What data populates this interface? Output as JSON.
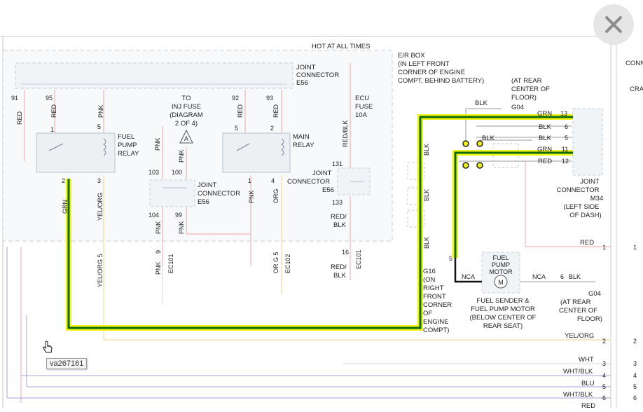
{
  "viewer": {
    "tooltip": "va267161"
  },
  "header": {
    "hot_at_all_times": "HOT AT ALL TIMES"
  },
  "right_panel": {
    "conn": "CONN",
    "cra": "CRA"
  },
  "components": {
    "joint_connector_e56_top": [
      "JOINT",
      "CONNECTOR",
      "E56"
    ],
    "fuel_pump_relay": [
      "FUEL",
      "PUMP",
      "RELAY"
    ],
    "main_relay": [
      "MAIN",
      "RELAY"
    ],
    "inj_fuse": [
      "TO",
      "INJ FUSE",
      "(DIAGRAM",
      "2 OF 4)"
    ],
    "inj_fuse_marker": "A",
    "joint_connector_e56_mid": [
      "JOINT",
      "CONNECTOR",
      "E56"
    ],
    "joint_connector_e56_right": [
      "JOINT",
      "CONNECTOR",
      "E56"
    ],
    "ecu_fuse": [
      "ECU",
      "FUSE",
      "10A"
    ],
    "er_box": [
      "E/R BOX",
      "(IN LEFT FRONT",
      "CORNER OF ENGINE",
      "COMPT, BEHIND BATTERY)"
    ],
    "g04_top": [
      "(AT REAR",
      "CENTER OF",
      "FLOOR)",
      "G04"
    ],
    "joint_connector_m34": [
      "JOINT",
      "CONNECTOR",
      "M34",
      "(LEFT SIDE",
      "OF DASH)"
    ],
    "fuel_pump_motor": [
      "FUEL",
      "PUMP",
      "MOTOR"
    ],
    "motor_symbol": "M",
    "fuel_sender": [
      "FUEL SENDER &",
      "FUEL PUMP MOTOR",
      "(BELOW CENTER OF",
      "REAR SEAT)"
    ],
    "g16": [
      "G16",
      "(ON",
      "RIGHT",
      "FRONT",
      "CORNER",
      "OF",
      "ENGINE",
      "COMPT)"
    ],
    "g04_bottom": [
      "G04",
      "(AT REAR",
      "CENTER OF",
      "FLOOR)"
    ]
  },
  "wires": {
    "red_91": "RED",
    "red_95": "RED",
    "pnk_5": "PNK",
    "red_92": "RED",
    "red_93": "RED",
    "pnk_inj": "PNK",
    "pnk_a": "PNK",
    "pnk_1": "PNK",
    "org_4": "ORG",
    "red_blk": "RED/BLK",
    "grn_2": "GRN",
    "yel_org_3": "YEL/ORG",
    "pnk_104": "PNK",
    "pnk_99": "PNK",
    "red_blk_133": [
      "RED/",
      "BLK"
    ],
    "yel_org_5": "YEL/ORG 5",
    "ec101_9": "9",
    "pnk_ec101": "PNK",
    "ec101": "EC101",
    "org_5": "OR G  5",
    "ec102": "EC102",
    "red_blk_16": [
      "RED/",
      "BLK"
    ],
    "pin16": "16",
    "ec101b": "EC101",
    "blk_g04": "BLK",
    "grn_13": "GRN",
    "blk_6": "BLK",
    "blk_5": "BLK",
    "grn_11": "GRN",
    "red_12": "RED",
    "blk_mid": "BLK",
    "blk_vert1": "BLK",
    "blk_vert2": "BLK",
    "blk_vert3": "BLK",
    "nca_left": "NCA",
    "nca_right": "NCA",
    "blk_right": "BLK",
    "pin6_bottom": "6",
    "red_bottom": "RED",
    "yel_org_bottom": "YEL/ORG",
    "wht": "WHT",
    "wht_blk": "WHT/BLK",
    "blu": "BLU",
    "wht_blk_2": "WHT/BLK",
    "red_last": "RED"
  },
  "pins": {
    "p91": "91",
    "p95": "95",
    "p92": "92",
    "p93": "93",
    "p1_fpr": "1",
    "p5_fpr": "5",
    "p2_fpr": "2",
    "p3_fpr": "3",
    "p5_mr": "5",
    "p2_mr": "2",
    "p1_mr": "1",
    "p4_mr": "4",
    "p103": "103",
    "p100": "100",
    "p104": "104",
    "p99": "99",
    "p131": "131",
    "p133": "133",
    "m13": "13",
    "m6": "6",
    "m5": "5",
    "m11": "11",
    "m12": "12",
    "p5_pump": "5",
    "r1": "1",
    "r2": "2",
    "r3": "3",
    "r4": "4",
    "r5": "5",
    "r6": "6",
    "rr1": "1",
    "rr2": "2",
    "rr3": "3",
    "rr4": "4",
    "rr5": "5",
    "rr6": "6"
  },
  "colors": {
    "highlight": "#f0f21a",
    "circuit": "#0b6b0b",
    "wire_red": "#f3b6b6",
    "wire_yel": "#f4d9a0",
    "wire_blue": "#b7b2e6",
    "dashed_box": "#c7d2dc"
  }
}
